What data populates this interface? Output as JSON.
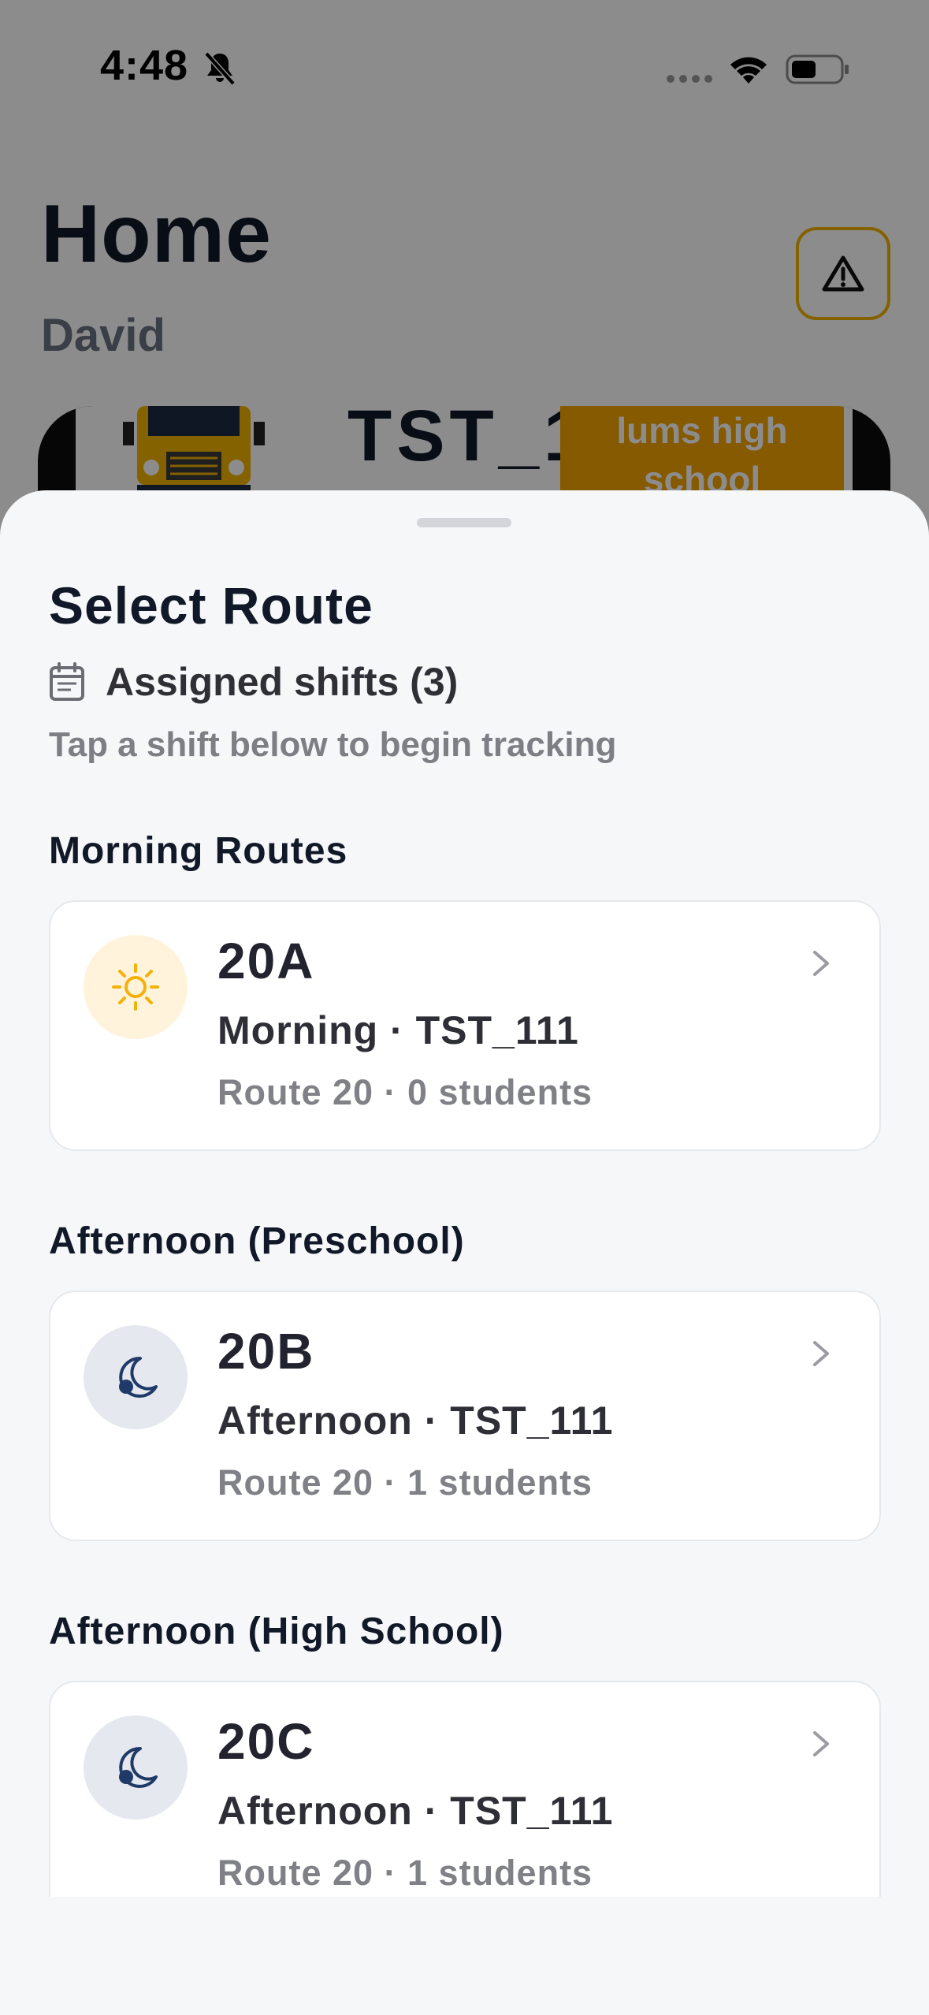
{
  "status_bar": {
    "time": "4:48",
    "icons": [
      "bell-slash-icon",
      "signal-icon",
      "wifi-icon",
      "battery-icon"
    ]
  },
  "background": {
    "title": "Home",
    "subtitle": "David",
    "alert_icon": "warning-triangle-icon",
    "bus_id": "TST_1",
    "school_name": "lums high school"
  },
  "sheet": {
    "title": "Select Route",
    "assigned_label": "Assigned shifts (3)",
    "hint": "Tap a shift below to begin tracking",
    "sections": [
      {
        "heading": "Morning Routes",
        "card": {
          "icon": "sun-icon",
          "code": "20A",
          "line": "Morning · TST_111",
          "meta": "Route 20 · 0 students"
        }
      },
      {
        "heading": "Afternoon (Preschool)",
        "card": {
          "icon": "moon-icon",
          "code": "20B",
          "line": "Afternoon · TST_111",
          "meta": "Route 20 · 1 students"
        }
      },
      {
        "heading": "Afternoon (High School)",
        "card": {
          "icon": "moon-icon",
          "code": "20C",
          "line": "Afternoon · TST_111",
          "meta": "Route 20 · 1 students"
        }
      }
    ]
  },
  "colors": {
    "accent_sun": "#f5b10a",
    "moon": "#1f3a68",
    "alert_border": "#f2b200",
    "school_badge": "#f2a400"
  }
}
